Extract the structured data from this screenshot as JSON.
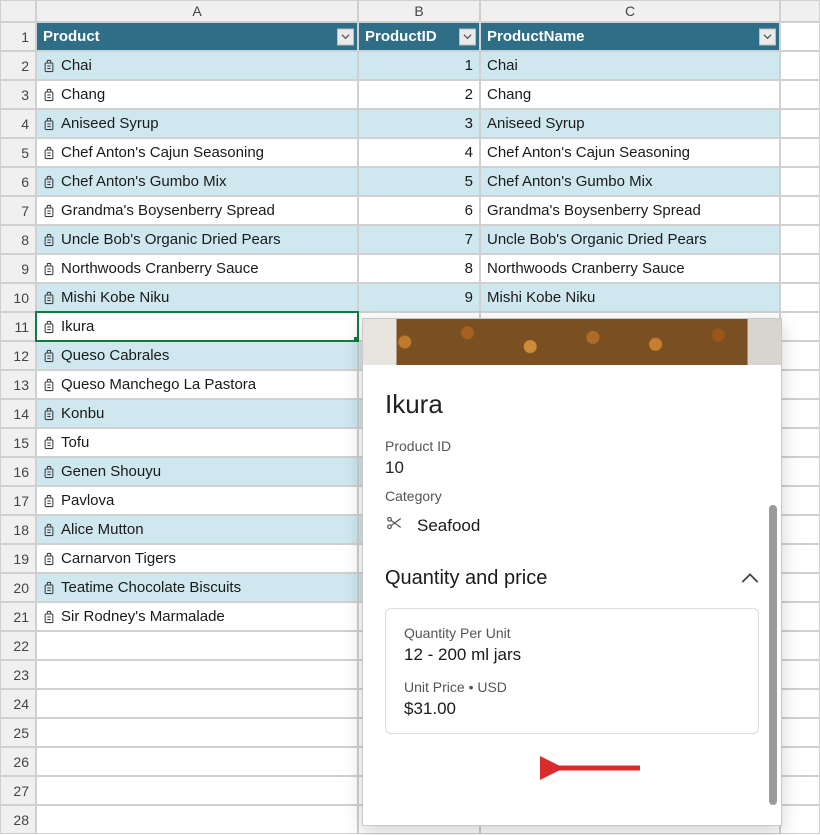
{
  "columns": {
    "a": "A",
    "b": "B",
    "c": "C"
  },
  "headers": {
    "product": "Product",
    "product_id": "ProductID",
    "product_name": "ProductName"
  },
  "rows": [
    {
      "n": 1
    },
    {
      "n": 2,
      "product": "Chai",
      "id": 1,
      "name": "Chai"
    },
    {
      "n": 3,
      "product": "Chang",
      "id": 2,
      "name": "Chang"
    },
    {
      "n": 4,
      "product": "Aniseed Syrup",
      "id": 3,
      "name": "Aniseed Syrup"
    },
    {
      "n": 5,
      "product": "Chef Anton's Cajun Seasoning",
      "id": 4,
      "name": "Chef Anton's Cajun Seasoning"
    },
    {
      "n": 6,
      "product": "Chef Anton's Gumbo Mix",
      "id": 5,
      "name": "Chef Anton's Gumbo Mix"
    },
    {
      "n": 7,
      "product": "Grandma's Boysenberry Spread",
      "id": 6,
      "name": "Grandma's Boysenberry Spread"
    },
    {
      "n": 8,
      "product": "Uncle Bob's Organic Dried Pears",
      "id": 7,
      "name": "Uncle Bob's Organic Dried Pears"
    },
    {
      "n": 9,
      "product": "Northwoods Cranberry Sauce",
      "id": 8,
      "name": "Northwoods Cranberry Sauce"
    },
    {
      "n": 10,
      "product": "Mishi Kobe Niku",
      "id": 9,
      "name": "Mishi Kobe Niku"
    },
    {
      "n": 11,
      "product": "Ikura"
    },
    {
      "n": 12,
      "product": "Queso Cabrales"
    },
    {
      "n": 13,
      "product": "Queso Manchego La Pastora"
    },
    {
      "n": 14,
      "product": "Konbu"
    },
    {
      "n": 15,
      "product": "Tofu"
    },
    {
      "n": 16,
      "product": "Genen Shouyu"
    },
    {
      "n": 17,
      "product": "Pavlova"
    },
    {
      "n": 18,
      "product": "Alice Mutton"
    },
    {
      "n": 19,
      "product": "Carnarvon Tigers"
    },
    {
      "n": 20,
      "product": "Teatime Chocolate Biscuits"
    },
    {
      "n": 21,
      "product": "Sir Rodney's Marmalade"
    },
    {
      "n": 22
    },
    {
      "n": 23
    },
    {
      "n": 24
    },
    {
      "n": 25
    },
    {
      "n": 26
    },
    {
      "n": 27
    },
    {
      "n": 28
    }
  ],
  "selected_row": 11,
  "card": {
    "title": "Ikura",
    "product_id_label": "Product ID",
    "product_id_value": "10",
    "category_label": "Category",
    "category_value": "Seafood",
    "section_title": "Quantity and price",
    "qpu_label": "Quantity Per Unit",
    "qpu_value": "12 - 200 ml jars",
    "unit_price_label": "Unit Price • USD",
    "unit_price_value": "$31.00"
  }
}
